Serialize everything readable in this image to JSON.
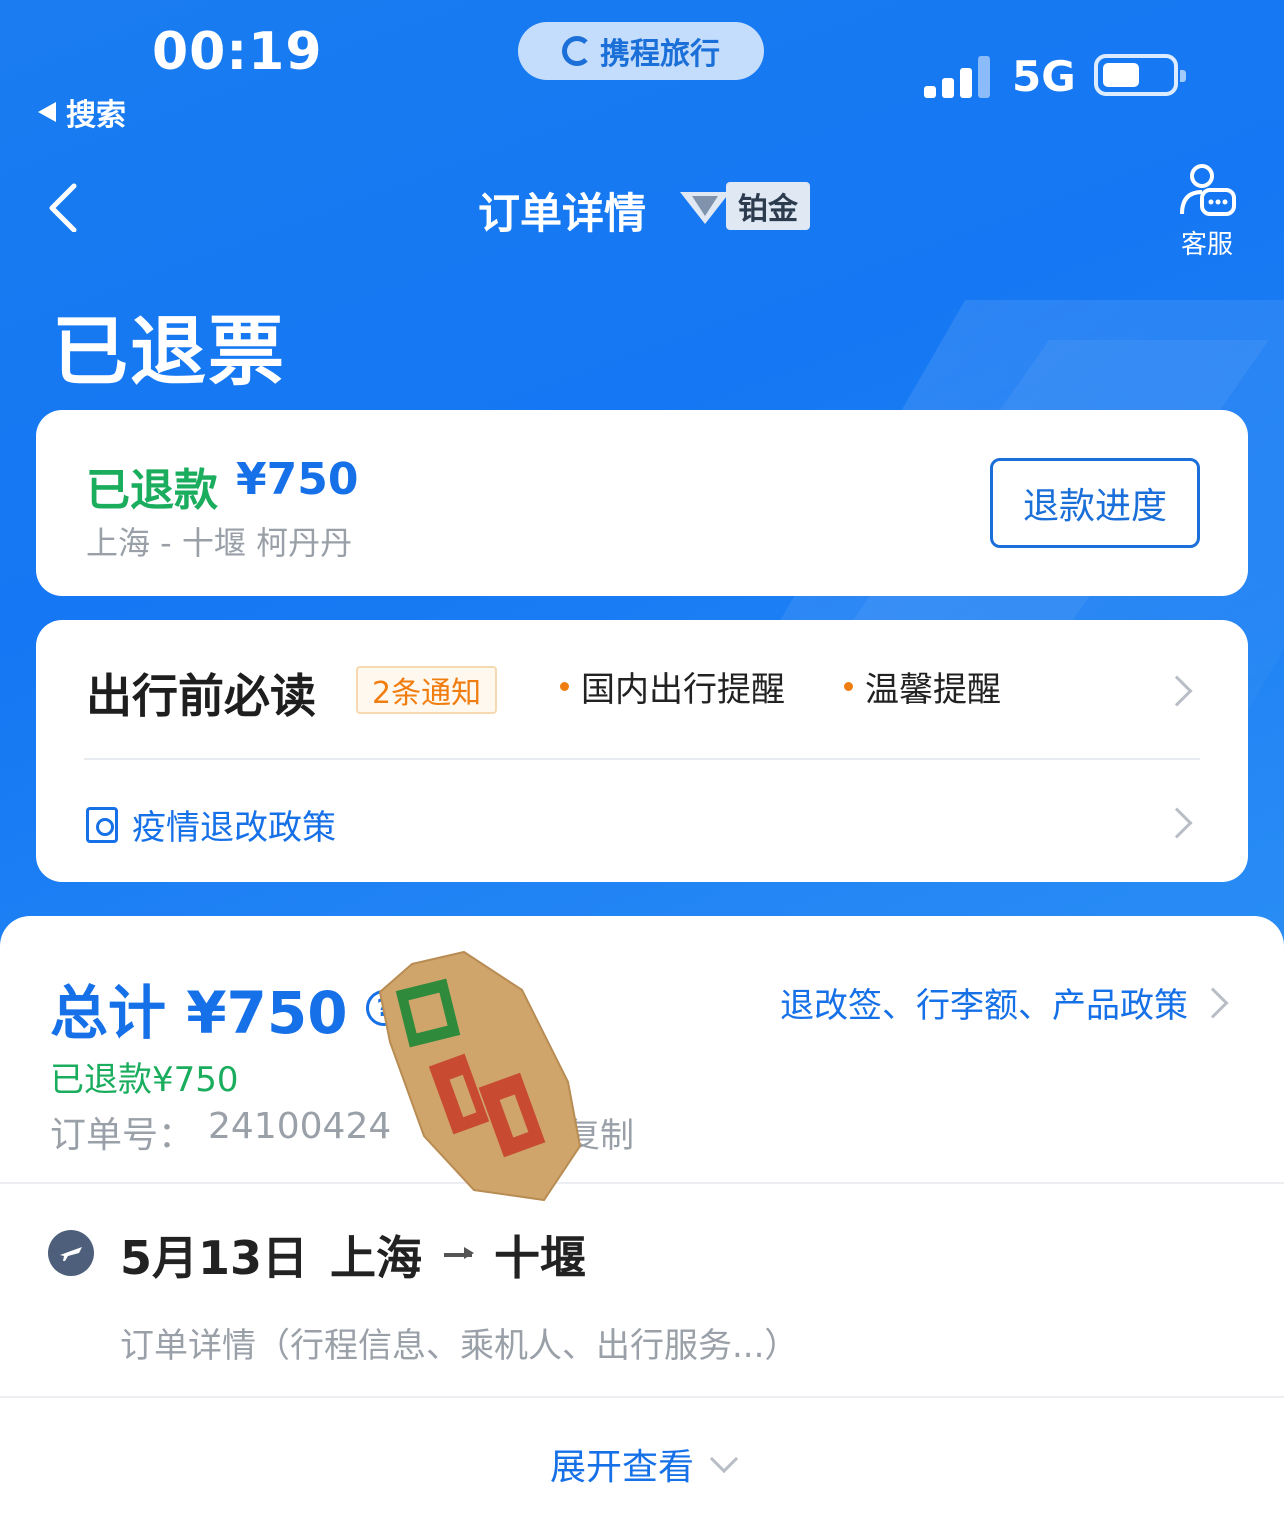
{
  "status_bar": {
    "time": "00:19",
    "back_app": "搜索",
    "brand": "携程旅行",
    "network": "5G",
    "battery_level": 0.45
  },
  "nav": {
    "title": "订单详情",
    "member_tier": "铂金",
    "service_label": "客服"
  },
  "page_status": "已退票",
  "refund_card": {
    "status": "已退款",
    "amount": "¥750",
    "route_passenger": "上海 - 十堰  柯丹丹",
    "progress_button": "退款进度"
  },
  "notice_card": {
    "title": "出行前必读",
    "badge": "2条通知",
    "items": [
      "国内出行提醒",
      "温馨提醒"
    ],
    "policy": "疫情退改政策"
  },
  "order": {
    "total": "总计 ¥750",
    "help_icon": "question-icon",
    "policy_link": "退改签、行李额、产品政策",
    "refunded": "已退款¥750",
    "order_label": "订单号：",
    "order_number": "24100424",
    "copy": "复制"
  },
  "flight": {
    "date": "5月13日",
    "from": "上海",
    "to": "十堰",
    "detail": "订单详情（行程信息、乘机人、出行服务...）",
    "expand": "展开查看"
  },
  "colors": {
    "brand_blue": "#1670e8",
    "hero_blue": "#1577f3",
    "success_green": "#1bad5e",
    "notice_orange": "#f07d10"
  }
}
